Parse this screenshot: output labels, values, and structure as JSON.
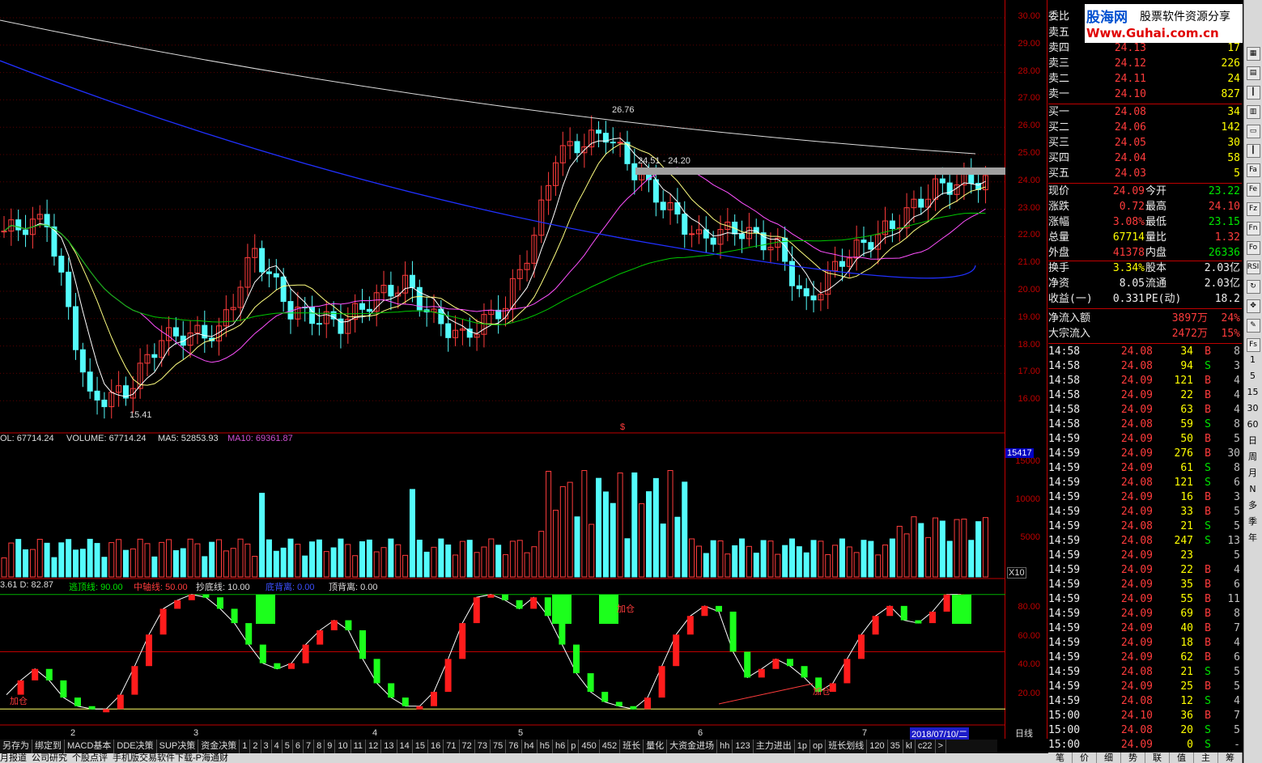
{
  "price_axis": [
    "30.00",
    "29.00",
    "28.00",
    "27.00",
    "26.00",
    "25.00",
    "24.00",
    "23.00",
    "22.00",
    "21.00",
    "20.00",
    "19.00",
    "18.00",
    "17.00",
    "16.00"
  ],
  "volume_axis": [
    "15000",
    "10000",
    "5000"
  ],
  "indicator_axis": [
    "80.00",
    "60.00",
    "40.00",
    "20.00"
  ],
  "annotations": {
    "high": "26.76",
    "low": "15.41",
    "range": "24.51 - 24.20",
    "add1": "加仓",
    "add2": "加仓",
    "add3": "加仓",
    "sym": "$"
  },
  "volume_label": {
    "vol": "OL: 67714.24",
    "volume": "VOLUME: 67714.24",
    "ma5": "MA5: 52853.93",
    "ma10": "MA10: 69361.87",
    "current": "15417",
    "mult": "X10"
  },
  "indicator_label": {
    "kd": "3.61  D: 82.87",
    "top": "逃顶线: 90.00",
    "mid": "中轴线: 50.00",
    "bottom": "抄底线: 10.00",
    "bottom_div": "底背离: 0.00",
    "top_div": "顶背离: 0.00"
  },
  "x_months": [
    "2",
    "3",
    "4",
    "5",
    "6",
    "7"
  ],
  "date_box": "2018/07/10/二",
  "period_label": "日线",
  "bottom_tabs": [
    "另存为",
    "绑定到",
    "MACD基本",
    "DDE决策",
    "SUP决策",
    "资金决策",
    "1",
    "2",
    "3",
    "4",
    "5",
    "6",
    "7",
    "8",
    "9",
    "10",
    "11",
    "12",
    "13",
    "14",
    "15",
    "16",
    "71",
    "72",
    "73",
    "75",
    "76",
    "h4",
    "h5",
    "h6",
    "p",
    "450",
    "452",
    "班长",
    "量化",
    "大资金进场",
    "hh",
    "123",
    "主力进出",
    "1p",
    "op",
    "班长划线",
    "120",
    "35",
    "kl",
    "c22",
    ">"
  ],
  "bottom_strip": [
    "月报道",
    "公司研究",
    "个股点评",
    "手机版交易软件下载-P海通财"
  ],
  "logo": {
    "title": "股海网",
    "sub": "股票软件资源分享",
    "url": "Www.Guhai.com.cn"
  },
  "order_book": {
    "wei_bi": "委比",
    "sell": [
      {
        "label": "卖五",
        "price": "",
        "vol": ""
      },
      {
        "label": "卖四",
        "price": "24.13",
        "vol": "17"
      },
      {
        "label": "卖三",
        "price": "24.12",
        "vol": "226"
      },
      {
        "label": "卖二",
        "price": "24.11",
        "vol": "24"
      },
      {
        "label": "卖一",
        "price": "24.10",
        "vol": "827"
      }
    ],
    "buy": [
      {
        "label": "买一",
        "price": "24.08",
        "vol": "34"
      },
      {
        "label": "买二",
        "price": "24.06",
        "vol": "142"
      },
      {
        "label": "买三",
        "price": "24.05",
        "vol": "30"
      },
      {
        "label": "买四",
        "price": "24.04",
        "vol": "58"
      },
      {
        "label": "买五",
        "price": "24.03",
        "vol": "5"
      }
    ]
  },
  "quote": [
    {
      "l1": "现价",
      "v1": "24.09",
      "c1": "red",
      "l2": "今开",
      "v2": "23.22",
      "c2": "green"
    },
    {
      "l1": "涨跌",
      "v1": "0.72",
      "c1": "red",
      "l2": "最高",
      "v2": "24.10",
      "c2": "red"
    },
    {
      "l1": "涨幅",
      "v1": "3.08%",
      "c1": "red",
      "l2": "最低",
      "v2": "23.15",
      "c2": "green"
    },
    {
      "l1": "总量",
      "v1": "67714",
      "c1": "yellow",
      "l2": "量比",
      "v2": "1.32",
      "c2": "red"
    },
    {
      "l1": "外盘",
      "v1": "41378",
      "c1": "red",
      "l2": "内盘",
      "v2": "26336",
      "c2": "green"
    },
    {
      "l1": "换手",
      "v1": "3.34%",
      "c1": "yellow",
      "l2": "股本",
      "v2": "2.03亿",
      "c2": "white"
    },
    {
      "l1": "净资",
      "v1": "8.05",
      "c1": "white",
      "l2": "流通",
      "v2": "2.03亿",
      "c2": "white"
    },
    {
      "l1": "收益(一)",
      "v1": "0.331",
      "c1": "white",
      "l2": "PE(动)",
      "v2": "18.2",
      "c2": "white"
    }
  ],
  "flows": [
    {
      "label": "净流入额",
      "value": "3897万",
      "pct": "24%"
    },
    {
      "label": "大宗流入",
      "value": "2472万",
      "pct": "15%"
    }
  ],
  "ticks": [
    {
      "t": "14:58",
      "p": "24.08",
      "v": "34",
      "d": "B",
      "n": "8"
    },
    {
      "t": "14:58",
      "p": "24.08",
      "v": "94",
      "d": "S",
      "n": "3"
    },
    {
      "t": "14:58",
      "p": "24.09",
      "v": "121",
      "d": "B",
      "n": "4"
    },
    {
      "t": "14:58",
      "p": "24.09",
      "v": "22",
      "d": "B",
      "n": "4"
    },
    {
      "t": "14:58",
      "p": "24.09",
      "v": "63",
      "d": "B",
      "n": "4"
    },
    {
      "t": "14:58",
      "p": "24.08",
      "v": "59",
      "d": "S",
      "n": "8"
    },
    {
      "t": "14:59",
      "p": "24.09",
      "v": "50",
      "d": "B",
      "n": "5"
    },
    {
      "t": "14:59",
      "p": "24.09",
      "v": "276",
      "d": "B",
      "n": "30"
    },
    {
      "t": "14:59",
      "p": "24.09",
      "v": "61",
      "d": "S",
      "n": "8"
    },
    {
      "t": "14:59",
      "p": "24.08",
      "v": "121",
      "d": "S",
      "n": "6"
    },
    {
      "t": "14:59",
      "p": "24.09",
      "v": "16",
      "d": "B",
      "n": "3"
    },
    {
      "t": "14:59",
      "p": "24.09",
      "v": "33",
      "d": "B",
      "n": "5"
    },
    {
      "t": "14:59",
      "p": "24.08",
      "v": "21",
      "d": "S",
      "n": "5"
    },
    {
      "t": "14:59",
      "p": "24.08",
      "v": "247",
      "d": "S",
      "n": "13"
    },
    {
      "t": "14:59",
      "p": "24.09",
      "v": "23",
      "d": "",
      "n": "5"
    },
    {
      "t": "14:59",
      "p": "24.09",
      "v": "22",
      "d": "B",
      "n": "4"
    },
    {
      "t": "14:59",
      "p": "24.09",
      "v": "35",
      "d": "B",
      "n": "6"
    },
    {
      "t": "14:59",
      "p": "24.09",
      "v": "55",
      "d": "B",
      "n": "11"
    },
    {
      "t": "14:59",
      "p": "24.09",
      "v": "69",
      "d": "B",
      "n": "8"
    },
    {
      "t": "14:59",
      "p": "24.09",
      "v": "40",
      "d": "B",
      "n": "7"
    },
    {
      "t": "14:59",
      "p": "24.09",
      "v": "18",
      "d": "B",
      "n": "4"
    },
    {
      "t": "14:59",
      "p": "24.09",
      "v": "62",
      "d": "B",
      "n": "6"
    },
    {
      "t": "14:59",
      "p": "24.08",
      "v": "21",
      "d": "S",
      "n": "5"
    },
    {
      "t": "14:59",
      "p": "24.09",
      "v": "25",
      "d": "B",
      "n": "5"
    },
    {
      "t": "14:59",
      "p": "24.08",
      "v": "12",
      "d": "S",
      "n": "4"
    },
    {
      "t": "15:00",
      "p": "24.10",
      "v": "36",
      "d": "B",
      "n": "7"
    },
    {
      "t": "15:00",
      "p": "24.08",
      "v": "20",
      "d": "S",
      "n": "5"
    },
    {
      "t": "15:00",
      "p": "24.09",
      "v": "0",
      "d": "S",
      "n": "-"
    }
  ],
  "right_tabs": [
    "笔",
    "价",
    "细",
    "势",
    "联",
    "值",
    "主",
    "筹"
  ],
  "toolbar_icons": [
    "grid-icon",
    "table-icon",
    "candle-icon",
    "bars-icon",
    "window-icon",
    "candle2-icon",
    "fa-icon",
    "fe-icon",
    "fz-icon",
    "fn-icon",
    "fo-icon",
    "rsi-icon",
    "refresh-icon",
    "move-icon",
    "pen-icon",
    "fs-icon"
  ],
  "toolbar_periods": [
    "1",
    "5",
    "15",
    "30",
    "60",
    "日",
    "周",
    "月",
    "N",
    "多",
    "季",
    "年"
  ]
}
